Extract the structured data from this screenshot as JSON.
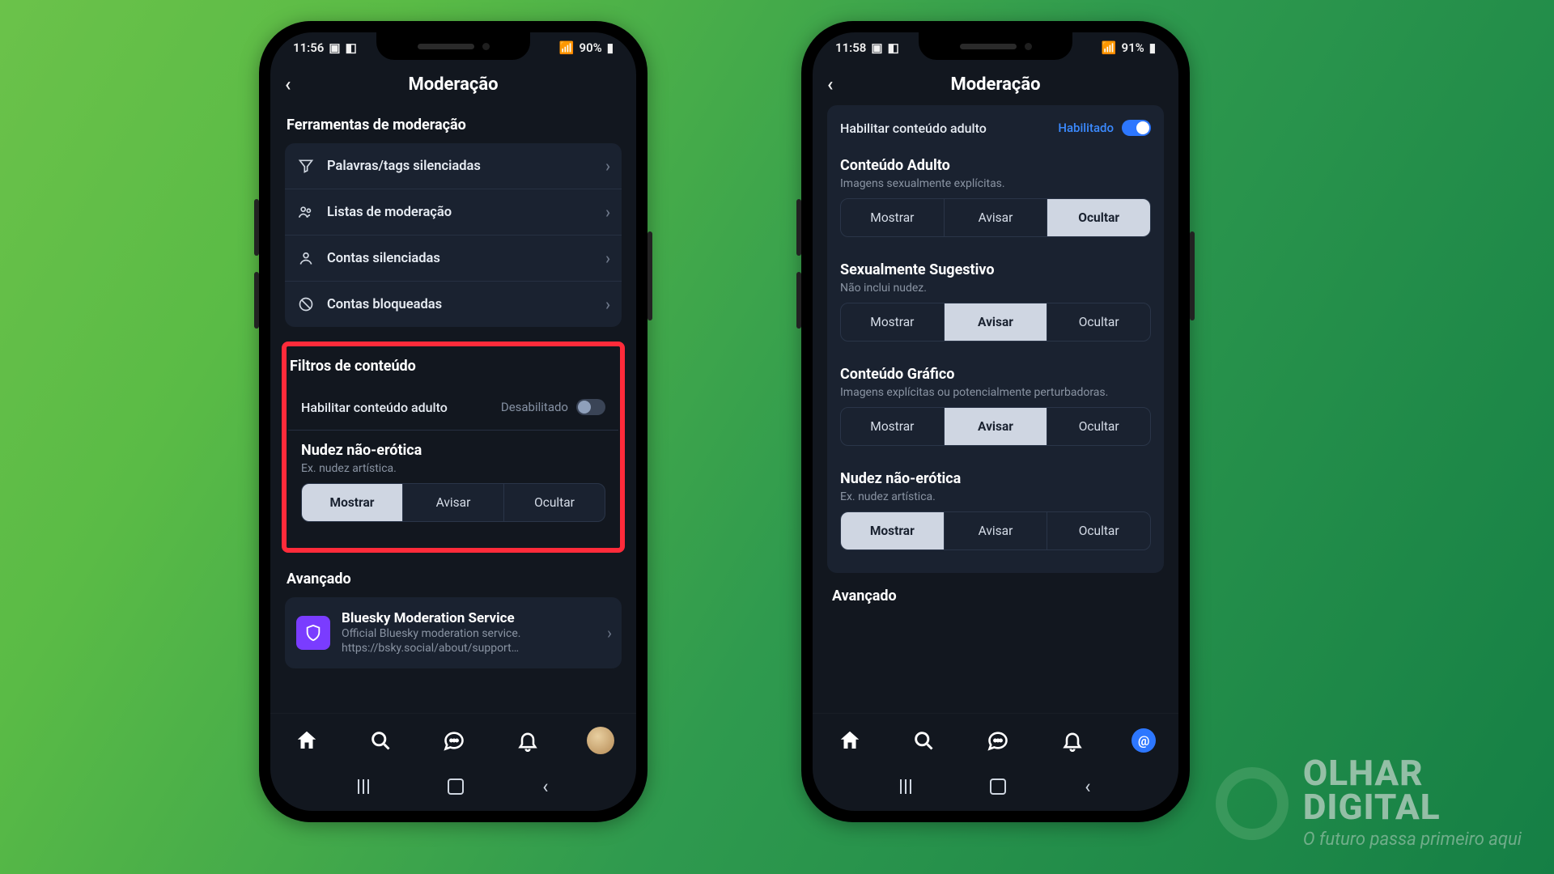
{
  "watermark": {
    "brand1": "OLHAR",
    "brand2": "DIGITAL",
    "tagline": "O futuro passa primeiro aqui"
  },
  "phone_left": {
    "status": {
      "time": "11:56",
      "battery": "90%"
    },
    "header": {
      "title": "Moderação"
    },
    "tools": {
      "title": "Ferramentas de moderação",
      "items": [
        {
          "label": "Palavras/tags silenciadas"
        },
        {
          "label": "Listas de moderação"
        },
        {
          "label": "Contas silenciadas"
        },
        {
          "label": "Contas bloqueadas"
        }
      ]
    },
    "filters": {
      "title": "Filtros de conteúdo",
      "toggle": {
        "label": "Habilitar conteúdo adulto",
        "state_label": "Desabilitado",
        "on": false
      },
      "block": {
        "title": "Nudez não-erótica",
        "desc": "Ex. nudez artística.",
        "options": [
          "Mostrar",
          "Avisar",
          "Ocultar"
        ],
        "selected": 0
      }
    },
    "advanced": {
      "title": "Avançado",
      "service": {
        "title": "Bluesky Moderation Service",
        "desc": "Official Bluesky moderation service. https://bsky.social/about/support…"
      }
    }
  },
  "phone_right": {
    "status": {
      "time": "11:58",
      "battery": "91%"
    },
    "header": {
      "title": "Moderação"
    },
    "toggle": {
      "label": "Habilitar conteúdo adulto",
      "state_label": "Habilitado",
      "on": true
    },
    "blocks": [
      {
        "title": "Conteúdo Adulto",
        "desc": "Imagens sexualmente explícitas.",
        "options": [
          "Mostrar",
          "Avisar",
          "Ocultar"
        ],
        "selected": 2
      },
      {
        "title": "Sexualmente Sugestivo",
        "desc": "Não inclui nudez.",
        "options": [
          "Mostrar",
          "Avisar",
          "Ocultar"
        ],
        "selected": 1
      },
      {
        "title": "Conteúdo Gráfico",
        "desc": "Imagens explícitas ou potencialmente perturbadoras.",
        "options": [
          "Mostrar",
          "Avisar",
          "Ocultar"
        ],
        "selected": 1
      },
      {
        "title": "Nudez não-erótica",
        "desc": "Ex. nudez artística.",
        "options": [
          "Mostrar",
          "Avisar",
          "Ocultar"
        ],
        "selected": 0
      }
    ],
    "advanced_title": "Avançado"
  }
}
